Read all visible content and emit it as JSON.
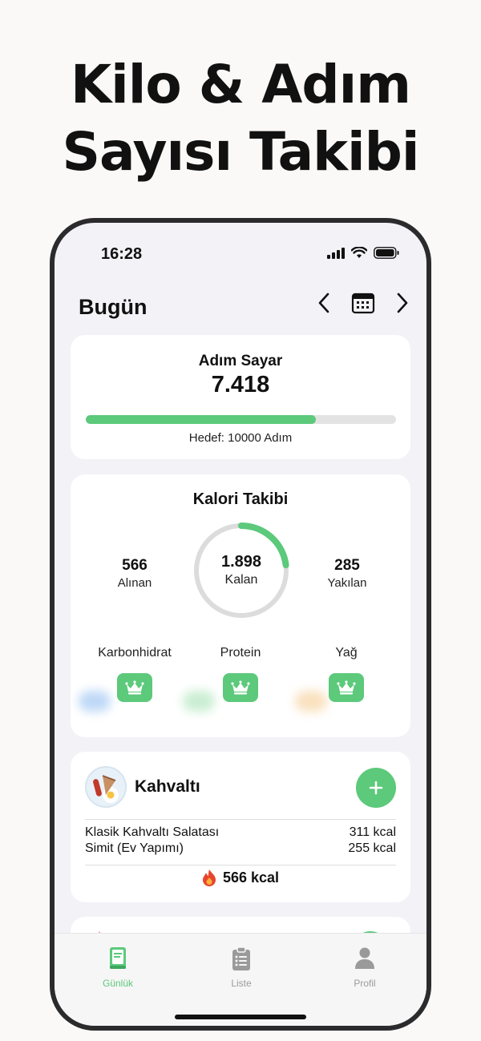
{
  "headline": {
    "line1": "Kilo & Adım",
    "line2": "Sayısı Takibi"
  },
  "status_bar": {
    "time": "16:28"
  },
  "nav": {
    "title": "Bugün"
  },
  "steps": {
    "title": "Adım Sayar",
    "value": "7.418",
    "goal_label": "Hedef: 10000 Adım",
    "progress": 0.7418
  },
  "calories": {
    "title": "Kalori Takibi",
    "consumed": {
      "value": "566",
      "label": "Alınan"
    },
    "remaining": {
      "value": "1.898",
      "label": "Kalan"
    },
    "burned": {
      "value": "285",
      "label": "Yakılan"
    },
    "ring_progress": 0.23,
    "macros": [
      {
        "label": "Karbonhidrat"
      },
      {
        "label": "Protein"
      },
      {
        "label": "Yağ"
      }
    ]
  },
  "meal": {
    "title": "Kahvaltı",
    "items": [
      {
        "name": "Klasik Kahvaltı Salatası",
        "kcal": "311 kcal"
      },
      {
        "name": "Simit (Ev Yapımı)",
        "kcal": "255 kcal"
      }
    ],
    "total": "566 kcal"
  },
  "tabs": [
    {
      "label": "Günlük",
      "icon": "book-icon",
      "active": true
    },
    {
      "label": "Liste",
      "icon": "clipboard-icon",
      "active": false
    },
    {
      "label": "Profil",
      "icon": "person-icon",
      "active": false
    }
  ],
  "colors": {
    "accent": "#5cc97b",
    "track": "#e3e3e3",
    "background": "#f2f2f7"
  }
}
